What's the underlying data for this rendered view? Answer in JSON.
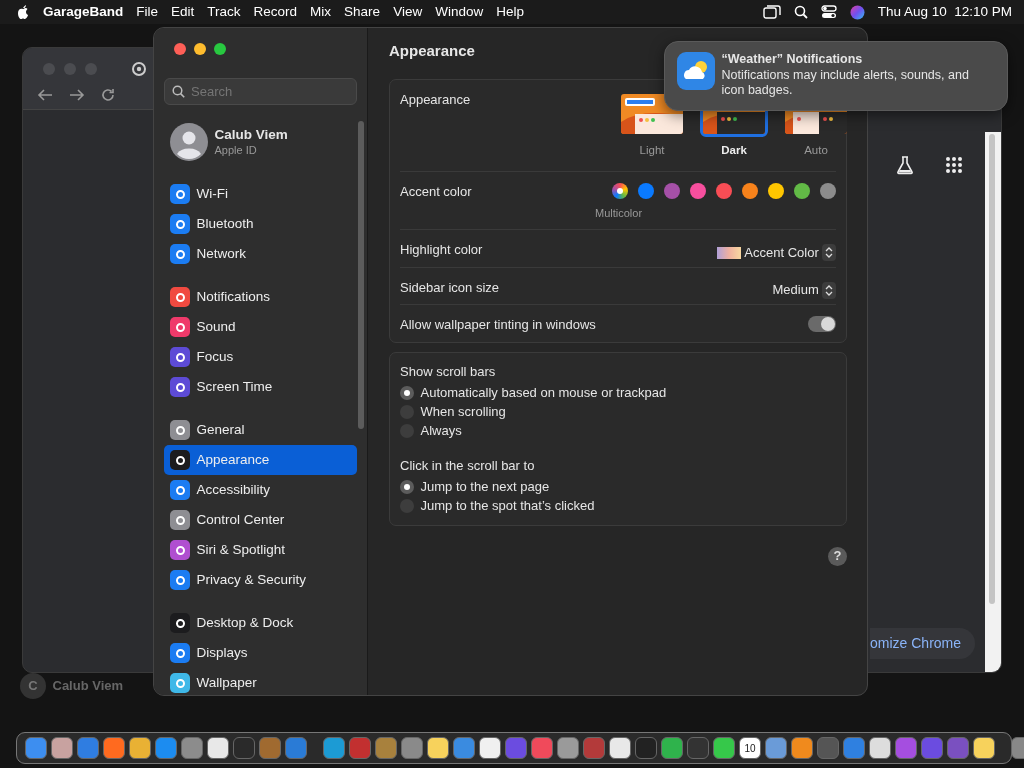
{
  "menu_bar": {
    "app": "GarageBand",
    "menus": [
      "File",
      "Edit",
      "Track",
      "Record",
      "Mix",
      "Share",
      "View",
      "Window",
      "Help"
    ],
    "clock": "Thu Aug 10  12:10 PM"
  },
  "browser_window": {
    "customize_button": "omize Chrome"
  },
  "background_profile": {
    "initial": "C",
    "name": "Calub Viem"
  },
  "settings_window": {
    "search": {
      "placeholder": "Search"
    },
    "account": {
      "name": "Calub Viem",
      "subtitle": "Apple ID"
    },
    "sidebar_groups": [
      [
        {
          "label": "Wi-Fi",
          "color": "#1b7cf2",
          "selected": false
        },
        {
          "label": "Bluetooth",
          "color": "#1b7cf2",
          "selected": false
        },
        {
          "label": "Network",
          "color": "#1b7cf2",
          "selected": false
        }
      ],
      [
        {
          "label": "Notifications",
          "color": "#f04a40",
          "selected": false
        },
        {
          "label": "Sound",
          "color": "#ef3a6a",
          "selected": false
        },
        {
          "label": "Focus",
          "color": "#5d4bd6",
          "selected": false
        },
        {
          "label": "Screen Time",
          "color": "#5d4bd6",
          "selected": false
        }
      ],
      [
        {
          "label": "General",
          "color": "#8e8e93",
          "selected": false
        },
        {
          "label": "Appearance",
          "color": "#1c1c1e",
          "selected": true
        },
        {
          "label": "Accessibility",
          "color": "#1b7cf2",
          "selected": false
        },
        {
          "label": "Control Center",
          "color": "#8e8e93",
          "selected": false
        },
        {
          "label": "Siri & Spotlight",
          "color": "#b04fd0",
          "selected": false
        },
        {
          "label": "Privacy & Security",
          "color": "#1b7cf2",
          "selected": false
        }
      ],
      [
        {
          "label": "Desktop & Dock",
          "color": "#1c1c1e",
          "selected": false
        },
        {
          "label": "Displays",
          "color": "#1b7cf2",
          "selected": false
        },
        {
          "label": "Wallpaper",
          "color": "#3fb8e8",
          "selected": false
        }
      ]
    ],
    "title": "Appearance",
    "appearance": {
      "label": "Appearance",
      "options": [
        {
          "label": "Light",
          "kind": "light",
          "selected": false
        },
        {
          "label": "Dark",
          "kind": "dark",
          "selected": true
        },
        {
          "label": "Auto",
          "kind": "auto",
          "selected": false
        }
      ]
    },
    "accent": {
      "label": "Accent color",
      "caption": "Multicolor",
      "colors": [
        {
          "kind": "multicolor",
          "selected": true
        },
        {
          "kind": "solid",
          "color": "#0a7aff",
          "selected": false
        },
        {
          "kind": "solid",
          "color": "#a550a7",
          "selected": false
        },
        {
          "kind": "solid",
          "color": "#f74f9e",
          "selected": false
        },
        {
          "kind": "solid",
          "color": "#f94d55",
          "selected": false
        },
        {
          "kind": "solid",
          "color": "#f7821b",
          "selected": false
        },
        {
          "kind": "solid",
          "color": "#ffc600",
          "selected": false
        },
        {
          "kind": "solid",
          "color": "#62ba46",
          "selected": false
        },
        {
          "kind": "solid",
          "color": "#8c8c8c",
          "selected": false
        }
      ]
    },
    "highlight": {
      "label": "Highlight color",
      "value": "Accent Color"
    },
    "sidebar_icon_size": {
      "label": "Sidebar icon size",
      "value": "Medium"
    },
    "wallpaper_tinting": {
      "label": "Allow wallpaper tinting in windows",
      "on": true
    },
    "scroll_bars": {
      "label": "Show scroll bars",
      "options": [
        {
          "label": "Automatically based on mouse or trackpad",
          "selected": true
        },
        {
          "label": "When scrolling",
          "selected": false
        },
        {
          "label": "Always",
          "selected": false
        }
      ]
    },
    "click_scroll_bar": {
      "label": "Click in the scroll bar to",
      "options": [
        {
          "label": "Jump to the next page",
          "selected": true
        },
        {
          "label": "Jump to the spot that’s clicked",
          "selected": false
        }
      ]
    },
    "help": "?"
  },
  "notification": {
    "title": "“Weather” Notifications",
    "body": "Notifications may include alerts, sounds, and icon badges."
  },
  "dock": [
    {
      "color": "#3d8ef0"
    },
    {
      "color": "#c8a2a0"
    },
    {
      "color": "#2f7de1"
    },
    {
      "color": "#ff6a1f"
    },
    {
      "color": "#e9b134"
    },
    {
      "color": "#1c8cf0"
    },
    {
      "color": "#8c8c8c"
    },
    {
      "color": "#e8e8e8"
    },
    {
      "color": "#2a2a2a"
    },
    {
      "color": "#a06a30"
    },
    {
      "color": "#2a7bd6"
    },
    {
      "color": "#1c9bd4"
    },
    {
      "color": "#c23030"
    },
    {
      "color": "#a8813d"
    },
    {
      "color": "#8a8a8a"
    },
    {
      "color": "#f7d25c"
    },
    {
      "color": "#3a8be0"
    },
    {
      "color": "#f0f0f0"
    },
    {
      "color": "#6b4ce0"
    },
    {
      "color": "#f04a5b"
    },
    {
      "color": "#9a9a9a"
    },
    {
      "color": "#b33a3a"
    },
    {
      "color": "#e8e8e8"
    },
    {
      "color": "#222222"
    },
    {
      "color": "#2fb34c"
    },
    {
      "color": "#333333"
    },
    {
      "color": "#36c84a"
    },
    {
      "color": "#ffffff",
      "label": "10"
    },
    {
      "color": "#6a9bd8"
    },
    {
      "color": "#f08a1d"
    },
    {
      "color": "#555555"
    },
    {
      "color": "#2f80e0"
    },
    {
      "color": "#dddddd"
    },
    {
      "color": "#a54ee0"
    },
    {
      "color": "#6b4ce0"
    },
    {
      "color": "#7a50c0"
    },
    {
      "color": "#f7d25c"
    },
    {
      "color": "#888888"
    }
  ]
}
